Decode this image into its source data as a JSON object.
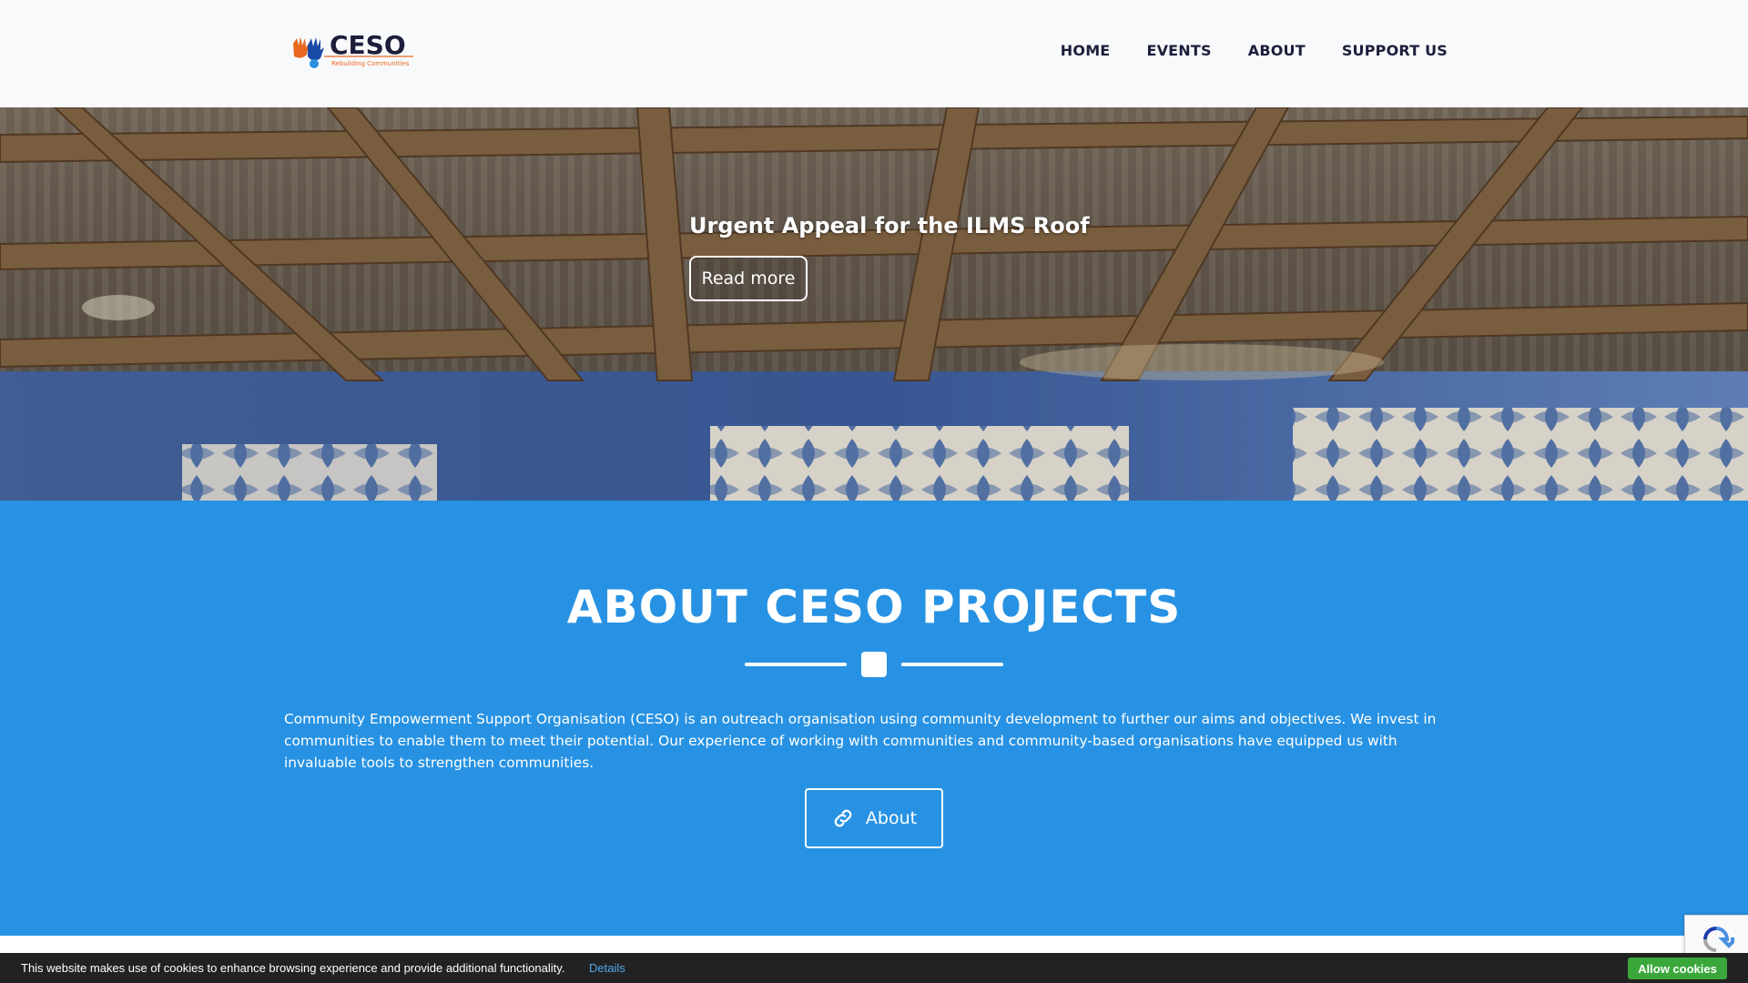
{
  "header": {
    "logo_text": "CESO",
    "logo_tagline": "Rebuilding Communities",
    "nav": [
      "HOME",
      "EVENTS",
      "ABOUT",
      "SUPPORT US"
    ]
  },
  "hero": {
    "title": "Urgent Appeal for the ILMS Roof",
    "button_label": "Read more"
  },
  "about": {
    "title": "ABOUT CESO PROJECTS",
    "text": "Community Empowerment Support Organisation (CESO) is an outreach organisation using community development to further our aims and objectives. We invest in communities to enable them to meet their potential. Our experience of working with communities and community-based organisations have equipped us with invaluable tools to strengthen communities.",
    "button_label": "About",
    "button_icon": "link-icon"
  },
  "cookie_bar": {
    "text": "This website makes use of cookies to enhance browsing experience and provide additional functionality.",
    "details_label": "Details",
    "allow_label": "Allow cookies"
  },
  "colors": {
    "accent_blue": "#2792e3",
    "nav_text": "#1d1d3b",
    "cookie_button": "#3aa73a"
  }
}
